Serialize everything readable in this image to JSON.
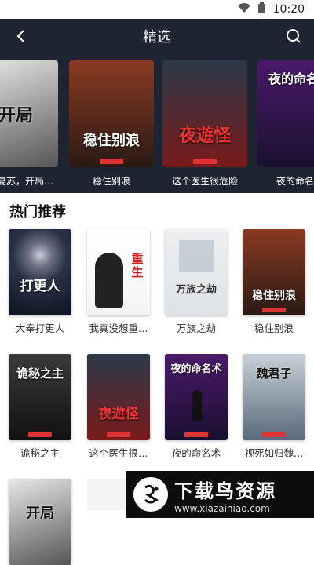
{
  "status": {
    "time": "10:20"
  },
  "header": {
    "title": "精选"
  },
  "carousel": [
    {
      "label": "灵气复苏，开局…",
      "cover_text": "开局",
      "colors": [
        "#e8e8e8",
        "#555"
      ]
    },
    {
      "label": "稳住别浪",
      "cover_text": "稳住别浪",
      "colors": [
        "#8a3a22",
        "#2a1a14"
      ]
    },
    {
      "label": "这个医生很危险",
      "cover_text": "夜遊怪",
      "colors": [
        "#2b3a4a",
        "#7a1a1a"
      ]
    },
    {
      "label": "夜的命名术",
      "cover_text": "夜的命名术",
      "colors": [
        "#4a1a6a",
        "#1a1030"
      ]
    }
  ],
  "section": {
    "title": "热门推荐"
  },
  "books": [
    {
      "name": "大奉打更人",
      "cover_text": "打更人",
      "colors": [
        "#2a3346",
        "#0d1220"
      ]
    },
    {
      "name": "我真没想重…",
      "cover_text": "重生",
      "colors": [
        "#ffffff",
        "#f4f4f4"
      ]
    },
    {
      "name": "万族之劫",
      "cover_text": "万族之劫",
      "colors": [
        "#eef0f2",
        "#dde2e6"
      ]
    },
    {
      "name": "稳住别浪",
      "cover_text": "稳住别浪",
      "colors": [
        "#8a3a22",
        "#2a1a14"
      ]
    },
    {
      "name": "诡秘之主",
      "cover_text": "诡秘之主",
      "colors": [
        "#3a3a3a",
        "#111"
      ]
    },
    {
      "name": "这个医生很…",
      "cover_text": "夜遊怪",
      "colors": [
        "#2b3a4a",
        "#7a1a1a"
      ]
    },
    {
      "name": "夜的命名术",
      "cover_text": "夜的命名术",
      "colors": [
        "#4a1a6a",
        "#1a1030"
      ]
    },
    {
      "name": "视死如归魏…",
      "cover_text": "魏君子",
      "colors": [
        "#c8d0d8",
        "#5a6a7a"
      ]
    },
    {
      "name": "",
      "cover_text": "开局",
      "colors": [
        "#e8e8e8",
        "#555"
      ]
    }
  ],
  "watermark": {
    "title": "下载鸟资源",
    "url": "www.xiazainiao.com"
  }
}
